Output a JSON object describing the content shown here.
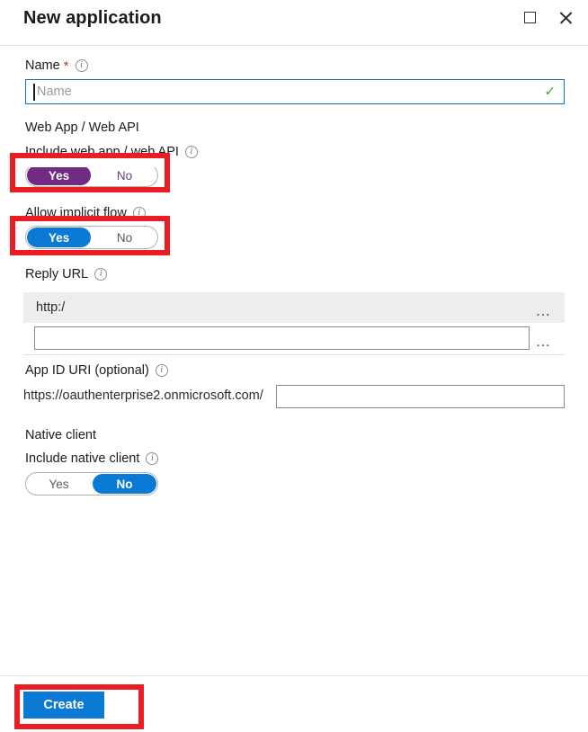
{
  "window": {
    "title": "New application",
    "maximize_icon": "maximize-icon",
    "close_icon": "close-icon"
  },
  "form": {
    "name_field": {
      "label": "Name",
      "required_marker": "*",
      "info_icon": "info-icon",
      "placeholder": "Name",
      "value": "",
      "validation_icon": "checkmark-icon",
      "valid": true
    },
    "web_app_section": {
      "header": "Web App / Web API",
      "include_toggle": {
        "label": "Include web app / web API",
        "info_icon": "info-icon",
        "yes_label": "Yes",
        "no_label": "No",
        "selected": "Yes",
        "accent_color": "#702A82"
      },
      "implicit_flow_toggle": {
        "label": "Allow implicit flow",
        "info_icon": "info-icon",
        "yes_label": "Yes",
        "no_label": "No",
        "selected": "Yes",
        "accent_color": "#0a7ad4"
      },
      "reply_url": {
        "label": "Reply URL",
        "info_icon": "info-icon",
        "rows": [
          {
            "value": "http:/",
            "more_icon": "ellipsis-icon"
          },
          {
            "value": "",
            "more_icon": "ellipsis-icon"
          }
        ]
      },
      "app_id_uri": {
        "label": "App ID URI (optional)",
        "info_icon": "info-icon",
        "prefix": "https://oauthenterprise2.onmicrosoft.com/",
        "value": ""
      }
    },
    "native_client_section": {
      "header": "Native client",
      "include_toggle": {
        "label": "Include native client",
        "info_icon": "info-icon",
        "yes_label": "Yes",
        "no_label": "No",
        "selected": "No",
        "accent_color": "#0a7ad4"
      }
    }
  },
  "footer": {
    "create_label": "Create"
  },
  "annotations": {
    "highlight_color": "#ec1c24",
    "boxes": [
      "include-web-app-toggle",
      "allow-implicit-flow-toggle",
      "create-button"
    ]
  }
}
